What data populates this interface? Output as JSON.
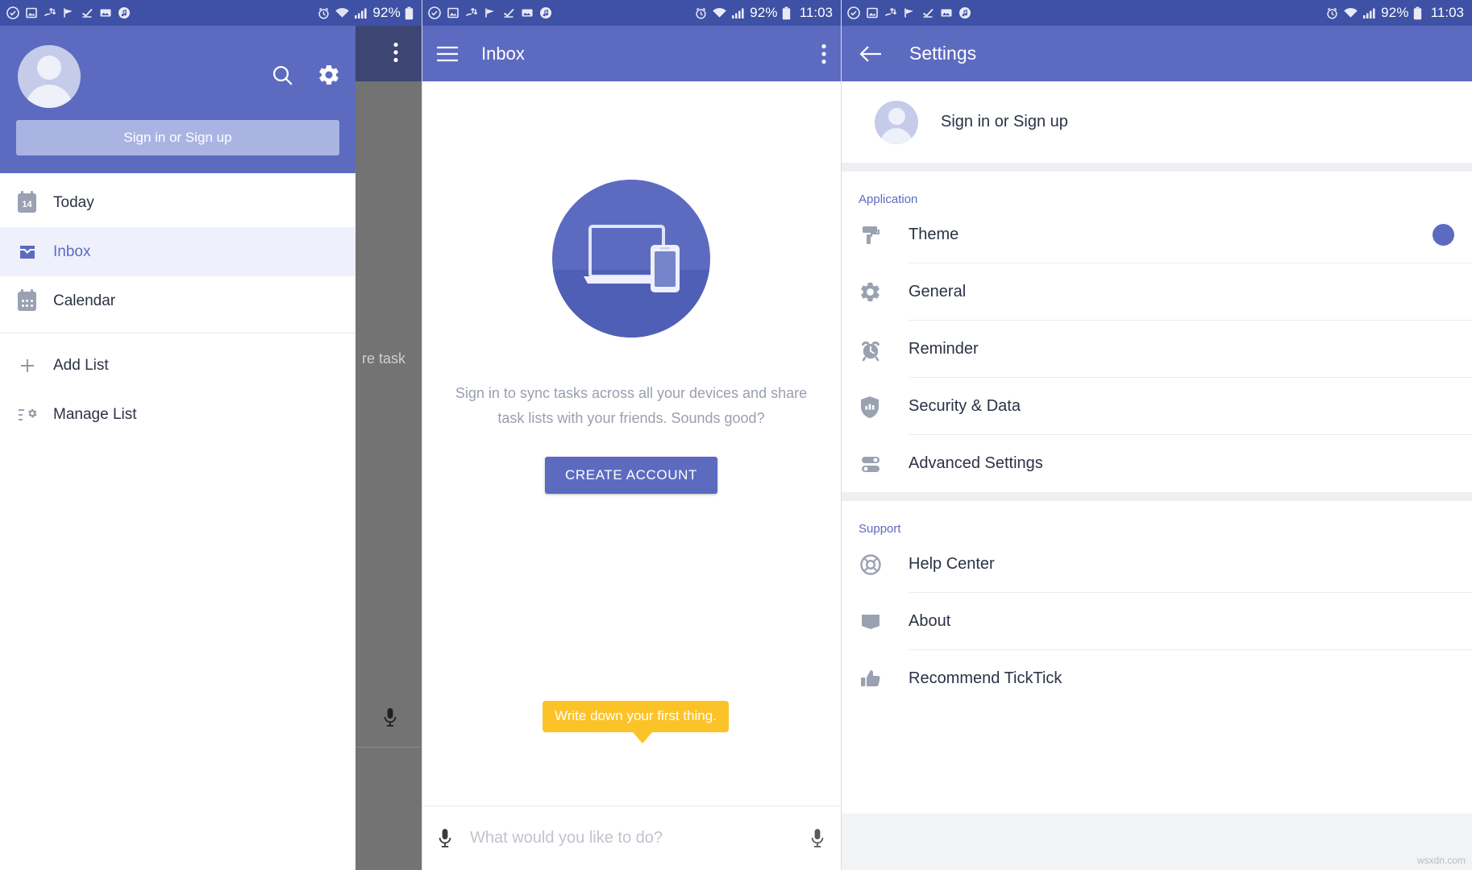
{
  "statusbar": {
    "notification_icons": [
      "check-circle-icon",
      "image-icon",
      "sync-icon",
      "flag-icon",
      "checkmark-icon",
      "photo-icon",
      "music-note-icon"
    ],
    "alarm_icon": "alarm-icon",
    "wifi_icon": "wifi-icon",
    "signal_icon": "signal-icon",
    "battery_percent": "92%",
    "battery_icon": "battery-icon",
    "time": "11:03"
  },
  "drawer": {
    "avatar": "default-avatar",
    "search_icon": "search-icon",
    "settings_icon": "gear-icon",
    "signin_label": "Sign in or Sign up",
    "items": [
      {
        "label": "Today",
        "icon": "calendar-today-icon",
        "badge": "14",
        "active": false
      },
      {
        "label": "Inbox",
        "icon": "inbox-icon",
        "active": true
      },
      {
        "label": "Calendar",
        "icon": "calendar-icon",
        "active": false
      }
    ],
    "secondary_items": [
      {
        "label": "Add List",
        "icon": "plus-icon"
      },
      {
        "label": "Manage List",
        "icon": "list-settings-icon"
      }
    ],
    "peek": {
      "kebab_icon": "more-vertical-icon",
      "task_text": "re task",
      "mic_icon": "microphone-icon"
    }
  },
  "inbox": {
    "menu_icon": "hamburger-menu-icon",
    "title": "Inbox",
    "overflow_icon": "more-vertical-icon",
    "illustration": "devices-sync-illustration",
    "empty_message": "Sign in to sync tasks across all your devices and share task lists with your friends. Sounds good?",
    "create_account_label": "CREATE ACCOUNT",
    "tooltip": "Write down your first thing.",
    "input_placeholder": "What would you like to do?",
    "mic_icon": "microphone-icon"
  },
  "settings": {
    "back_icon": "arrow-left-icon",
    "title": "Settings",
    "account": {
      "avatar": "default-avatar",
      "label": "Sign in or Sign up"
    },
    "sections": [
      {
        "title": "Application",
        "items": [
          {
            "label": "Theme",
            "icon": "paint-roller-icon",
            "accessory": "color-dot",
            "color": "#5c6bc0"
          },
          {
            "label": "General",
            "icon": "gear-icon"
          },
          {
            "label": "Reminder",
            "icon": "alarm-clock-icon"
          },
          {
            "label": "Security & Data",
            "icon": "shield-icon"
          },
          {
            "label": "Advanced Settings",
            "icon": "toggles-icon"
          }
        ]
      },
      {
        "title": "Support",
        "items": [
          {
            "label": "Help Center",
            "icon": "lifebuoy-icon"
          },
          {
            "label": "About",
            "icon": "book-icon"
          },
          {
            "label": "Recommend TickTick",
            "icon": "thumbs-up-icon"
          }
        ]
      }
    ]
  },
  "watermark": "wsxdn.com",
  "colors": {
    "primary": "#5c6bc0",
    "status_bar": "#3f51a5",
    "accent_yellow": "#fcc328",
    "text": "#2b3245",
    "muted": "#9a9fae"
  }
}
